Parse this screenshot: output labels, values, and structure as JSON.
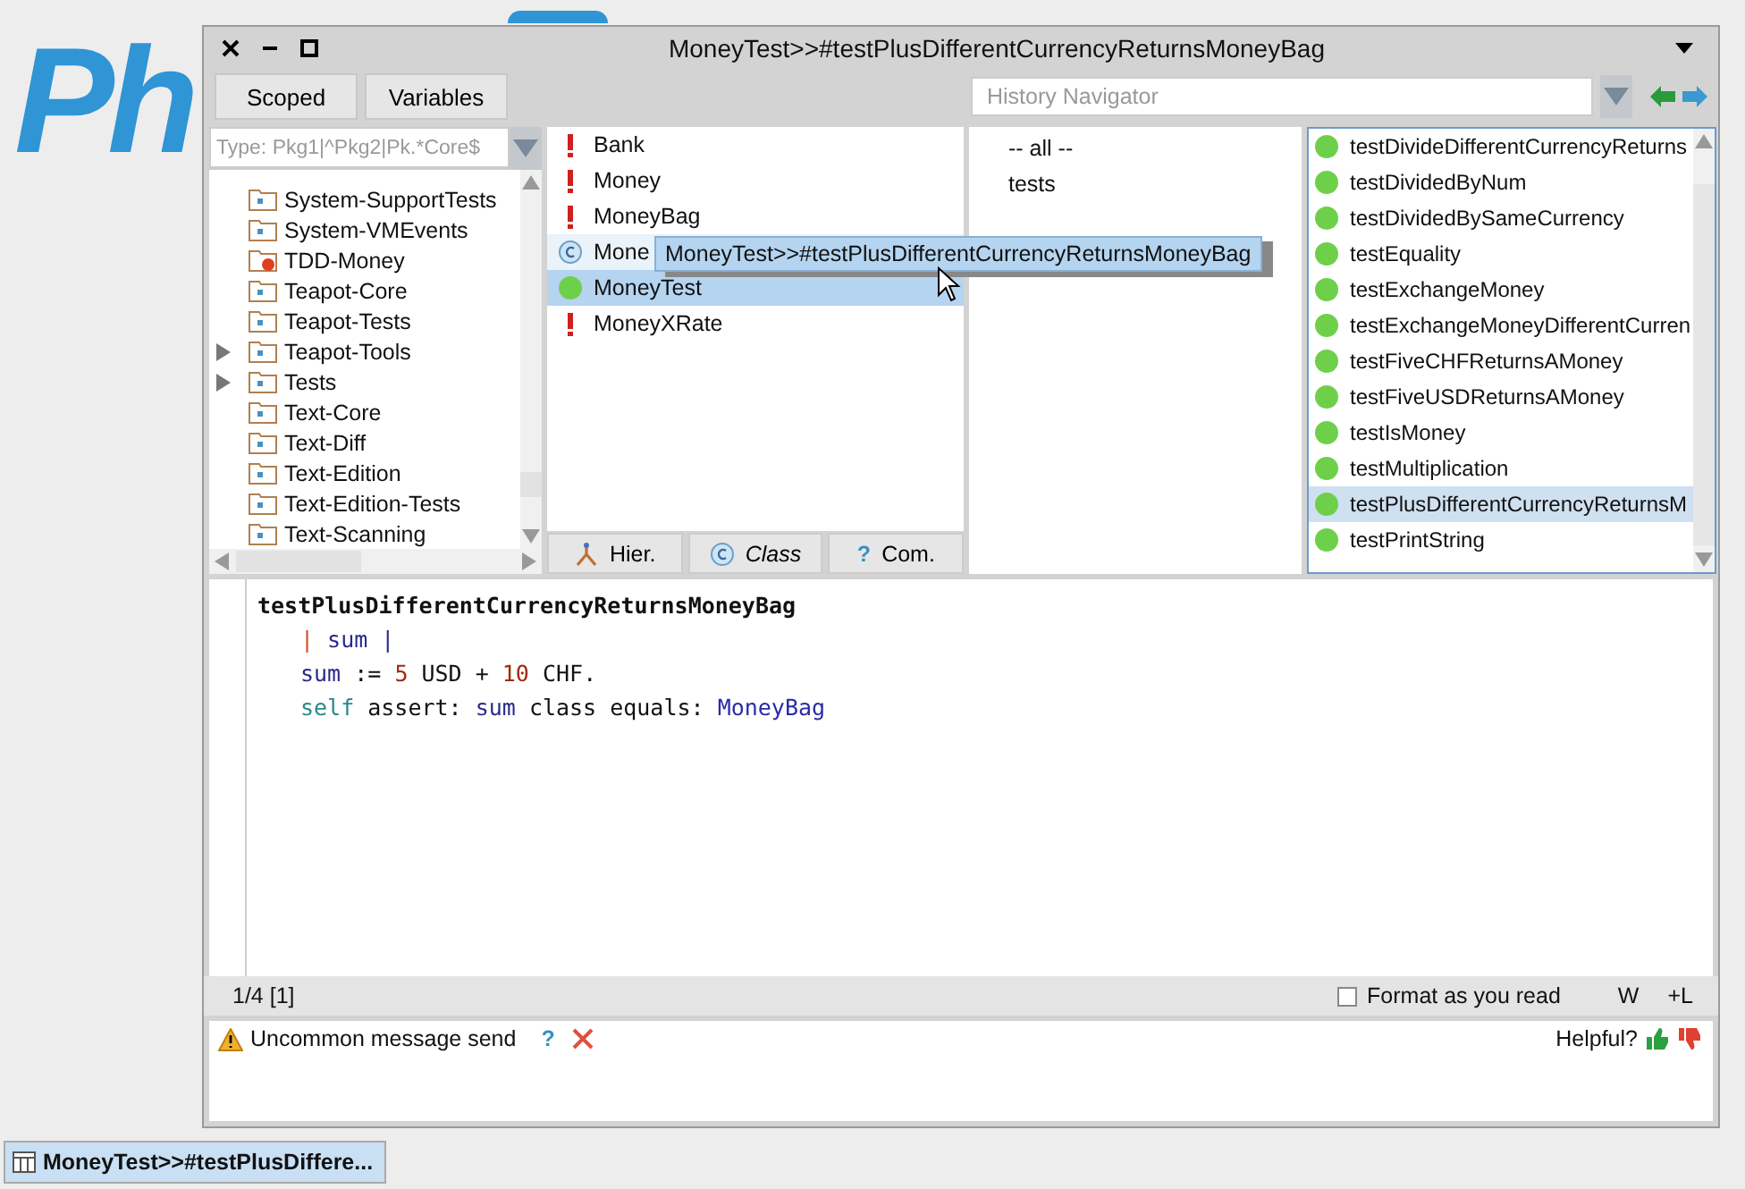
{
  "background_logo": "Ph",
  "window": {
    "title": "MoneyTest>>#testPlusDifferentCurrencyReturnsMoneyBag"
  },
  "toolbar": {
    "buttons": [
      "Scoped",
      "Variables"
    ],
    "history": {
      "placeholder": "History Navigator"
    }
  },
  "packages": {
    "filter": {
      "placeholder": "Type: Pkg1|^Pkg2|Pk.*Core$"
    },
    "items": [
      {
        "name": "System-SupportTests",
        "kind": "package",
        "expandable": false
      },
      {
        "name": "System-VMEvents",
        "kind": "package",
        "expandable": false
      },
      {
        "name": "TDD-Money",
        "kind": "extended",
        "expandable": false
      },
      {
        "name": "Teapot-Core",
        "kind": "package",
        "expandable": false
      },
      {
        "name": "Teapot-Tests",
        "kind": "package",
        "expandable": false
      },
      {
        "name": "Teapot-Tools",
        "kind": "package",
        "expandable": true
      },
      {
        "name": "Tests",
        "kind": "package",
        "expandable": true
      },
      {
        "name": "Text-Core",
        "kind": "package",
        "expandable": false
      },
      {
        "name": "Text-Diff",
        "kind": "package",
        "expandable": false
      },
      {
        "name": "Text-Edition",
        "kind": "package",
        "expandable": false
      },
      {
        "name": "Text-Edition-Tests",
        "kind": "package",
        "expandable": false
      },
      {
        "name": "Text-Scanning",
        "kind": "package",
        "expandable": false
      }
    ]
  },
  "classes": {
    "items": [
      {
        "name": "Bank",
        "kind": "error",
        "selected": false,
        "hovered": false
      },
      {
        "name": "Money",
        "kind": "error",
        "selected": false,
        "hovered": false
      },
      {
        "name": "MoneyBag",
        "kind": "error",
        "selected": false,
        "hovered": false
      },
      {
        "name": "Mone",
        "kind": "class",
        "selected": false,
        "hovered": true
      },
      {
        "name": "MoneyTest",
        "kind": "pass",
        "selected": true,
        "hovered": false
      },
      {
        "name": "MoneyXRate",
        "kind": "error",
        "selected": false,
        "hovered": false
      }
    ],
    "buttons": [
      {
        "label": "Hier.",
        "kind": "hier"
      },
      {
        "label": "Class",
        "kind": "class"
      },
      {
        "label": "Com.",
        "kind": "comment",
        "glyph": "?"
      }
    ]
  },
  "protocols": {
    "items": [
      {
        "name": "-- all --"
      },
      {
        "name": "tests"
      }
    ]
  },
  "methods": {
    "items": [
      {
        "name": "testDivideDifferentCurrencyReturns",
        "selected": false
      },
      {
        "name": "testDividedByNum",
        "selected": false
      },
      {
        "name": "testDividedBySameCurrency",
        "selected": false
      },
      {
        "name": "testEquality",
        "selected": false
      },
      {
        "name": "testExchangeMoney",
        "selected": false
      },
      {
        "name": "testExchangeMoneyDifferentCurren",
        "selected": false
      },
      {
        "name": "testFiveCHFReturnsAMoney",
        "selected": false
      },
      {
        "name": "testFiveUSDReturnsAMoney",
        "selected": false
      },
      {
        "name": "testIsMoney",
        "selected": false
      },
      {
        "name": "testMultiplication",
        "selected": false
      },
      {
        "name": "testPlusDifferentCurrencyReturnsM",
        "selected": true
      },
      {
        "name": "testPrintString",
        "selected": false
      }
    ]
  },
  "tooltip": "MoneyTest>>#testPlusDifferentCurrencyReturnsMoneyBag",
  "code": {
    "lines": [
      {
        "kind": "header",
        "tokens": [
          {
            "text": "testPlusDifferentCurrencyReturnsMoneyBag",
            "kind": "selector"
          }
        ]
      },
      {
        "kind": "body",
        "tokens": [
          {
            "text": "|",
            "kind": "delim"
          },
          {
            "text": " sum |",
            "kind": "var"
          }
        ]
      },
      {
        "kind": "body",
        "tokens": [
          {
            "text": "sum",
            "kind": "var"
          },
          {
            "text": " := ",
            "kind": "plain"
          },
          {
            "text": "5",
            "kind": "num"
          },
          {
            "text": " USD + ",
            "kind": "plain"
          },
          {
            "text": "10",
            "kind": "num"
          },
          {
            "text": " CHF.",
            "kind": "plain"
          }
        ]
      },
      {
        "kind": "body",
        "tokens": [
          {
            "text": "self",
            "kind": "self"
          },
          {
            "text": " assert: ",
            "kind": "plain"
          },
          {
            "text": "sum",
            "kind": "var"
          },
          {
            "text": " class equals: ",
            "kind": "plain"
          },
          {
            "text": "MoneyBag",
            "kind": "global"
          }
        ]
      }
    ]
  },
  "status": {
    "position": "1/4 [1]",
    "format": {
      "label": "Format as you read",
      "checked": false
    },
    "toggles": [
      "W",
      "+L"
    ]
  },
  "critique": {
    "message": "Uncommon message send",
    "help": "?",
    "helpful": "Helpful?"
  },
  "taskbar": [
    {
      "label": "MoneyTest>>#testPlusDiffere...",
      "selected": true
    }
  ]
}
